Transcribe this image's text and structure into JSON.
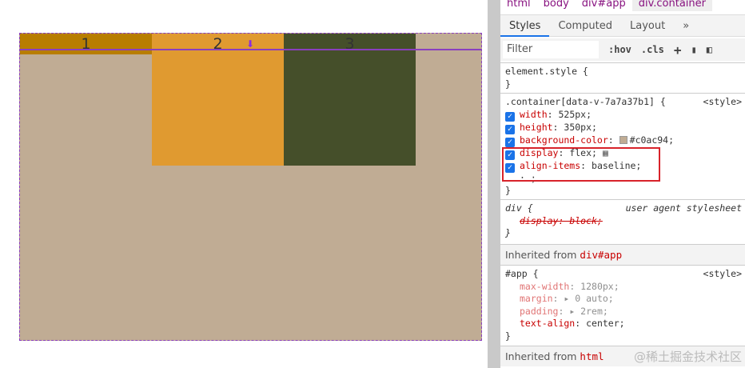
{
  "preview": {
    "items": [
      "1",
      "2",
      "3"
    ]
  },
  "devtools": {
    "breadcrumbs": [
      "html",
      "body",
      "div#app",
      "div.container"
    ],
    "tabs": [
      "Styles",
      "Computed",
      "Layout",
      "»"
    ],
    "filter_placeholder": "Filter",
    "hov": ":hov",
    "cls": ".cls",
    "element_style": "element.style {",
    "close": "}",
    "rule1": {
      "selector": ".container[data-v-7a7a37b1] {",
      "source": "<style>",
      "props": [
        {
          "p": "width",
          "v": "525px;"
        },
        {
          "p": "height",
          "v": "350px;"
        },
        {
          "p": "background-color",
          "v": "#c0ac94;"
        },
        {
          "p": "display",
          "v": "flex;"
        },
        {
          "p": "align-items",
          "v": "baseline;"
        }
      ],
      "empty": ": ;"
    },
    "rule2": {
      "selector": "div {",
      "source": "user agent stylesheet",
      "prop": "display: block;"
    },
    "inherit1": {
      "label": "Inherited from",
      "el": "div#app"
    },
    "rule3": {
      "selector": "#app {",
      "source": "<style>",
      "props": [
        {
          "p": "max-width",
          "v": "1280px;"
        },
        {
          "p": "margin",
          "v": "▸ 0 auto;"
        },
        {
          "p": "padding",
          "v": "▸ 2rem;"
        },
        {
          "p": "text-align",
          "v": "center;"
        }
      ]
    },
    "inherit2": {
      "label": "Inherited from",
      "el": "html"
    },
    "watermark": "@稀土掘金技术社区"
  }
}
